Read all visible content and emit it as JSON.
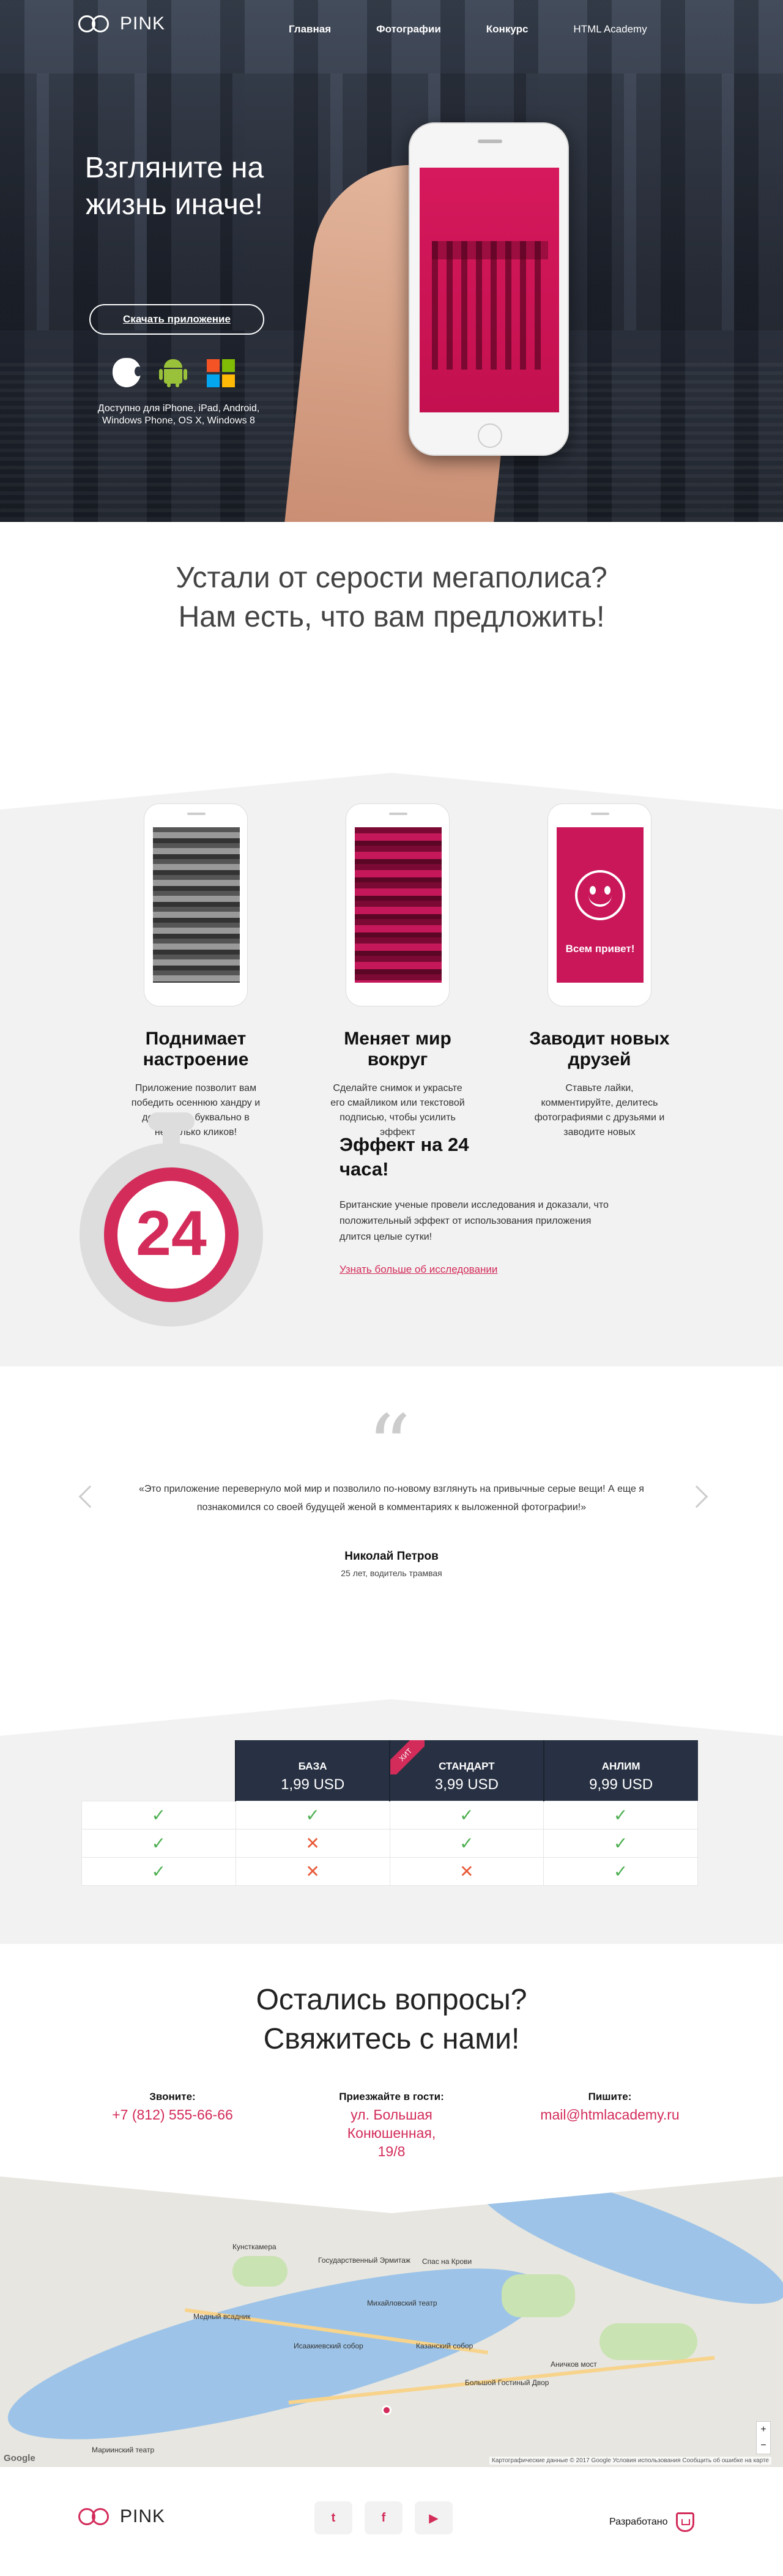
{
  "nav": {
    "logo": "PINK",
    "items": [
      {
        "label": "Главная"
      },
      {
        "label": "Фотографии"
      },
      {
        "label": "Конкурс"
      },
      {
        "label": "HTML Academy"
      }
    ]
  },
  "hero": {
    "title": "Взгляните на жизнь иначе!",
    "download_label": "Скачать приложение",
    "platforms": [
      "apple-icon",
      "android-icon",
      "windows-icon"
    ],
    "availability": "Доступно для iPhone, iPad, Android, Windows Phone, OS X, Windows 8"
  },
  "promo": {
    "heading": "Устали от серости мегаполиса? Нам есть, что вам предложить!"
  },
  "features": [
    {
      "title": "Поднимает настроение",
      "text": "Приложение позволит вам победить осеннюю хандру и депрессию буквально в несколько кликов!"
    },
    {
      "title": "Меняет мир вокруг",
      "text": "Сделайте снимок и украсьте его смайликом или текстовой подписью, чтобы усилить эффект"
    },
    {
      "title": "Заводит новых друзей",
      "text": "Ставьте лайки, комментируйте, делитесь фотографиями с друзьями и заводите новых",
      "screen_text": "Всем привет!"
    }
  ],
  "effect": {
    "number": "24",
    "title": "Эффект на 24 часа!",
    "text": "Британские ученые провели исследования и доказали, что положительный эффект от использования приложения длится целые сутки!",
    "link": "Узнать больше об исследовании"
  },
  "review": {
    "quote_mark": "“",
    "text": "«Это приложение перевернуло мой мир и позволило по-новому взглянуть на привычные серые вещи! А еще я познакомился со своей будущей женой в комментариях к выложенной фотографии!»",
    "name": "Николай Петров",
    "role": "25 лет, водитель трамвая"
  },
  "pricing": {
    "hit_label": "ХИТ",
    "plans": [
      {
        "name": "БАЗА",
        "price": "1,99 USD"
      },
      {
        "name": "СТАНДАРТ",
        "price": "3,99 USD"
      },
      {
        "name": "АНЛИМ",
        "price": "9,99 USD"
      }
    ],
    "rows": [
      [
        "✓",
        "✓",
        "✓",
        "✓"
      ],
      [
        "✓",
        "✕",
        "✓",
        "✓"
      ],
      [
        "✓",
        "✕",
        "✕",
        "✓"
      ]
    ]
  },
  "contacts": {
    "heading": "Остались вопросы? Свяжитесь с нами!",
    "phone_label": "Звоните:",
    "phone": "+7 (812) 555-66-66",
    "address_label": "Приезжайте в гости:",
    "address": "ул. Большая Конюшенная, 19/8",
    "email_label": "Пишите:",
    "email": "mail@htmlacademy.ru"
  },
  "map": {
    "labels": [
      "Кунсткамера",
      "Государственный Эрмитаж",
      "Спас на Крови",
      "Медный всадник",
      "Михайловский театр",
      "Исаакиевский собор",
      "Казанский собор",
      "Аничков мост",
      "Большой Гостиный Двор",
      "Мариинский театр"
    ],
    "google": "Google",
    "attribution": "Картографические данные © 2017 Google   Условия использования   Сообщить об ошибке на карте",
    "zoom_in": "+",
    "zoom_out": "−"
  },
  "footer": {
    "logo": "PINK",
    "social": [
      "twitter-icon",
      "facebook-icon",
      "youtube-icon"
    ],
    "made_by": "Разработано"
  },
  "colors": {
    "accent": "#d32c5a",
    "dark": "#283143",
    "ok": "#4caf50",
    "no": "#e85a38"
  }
}
